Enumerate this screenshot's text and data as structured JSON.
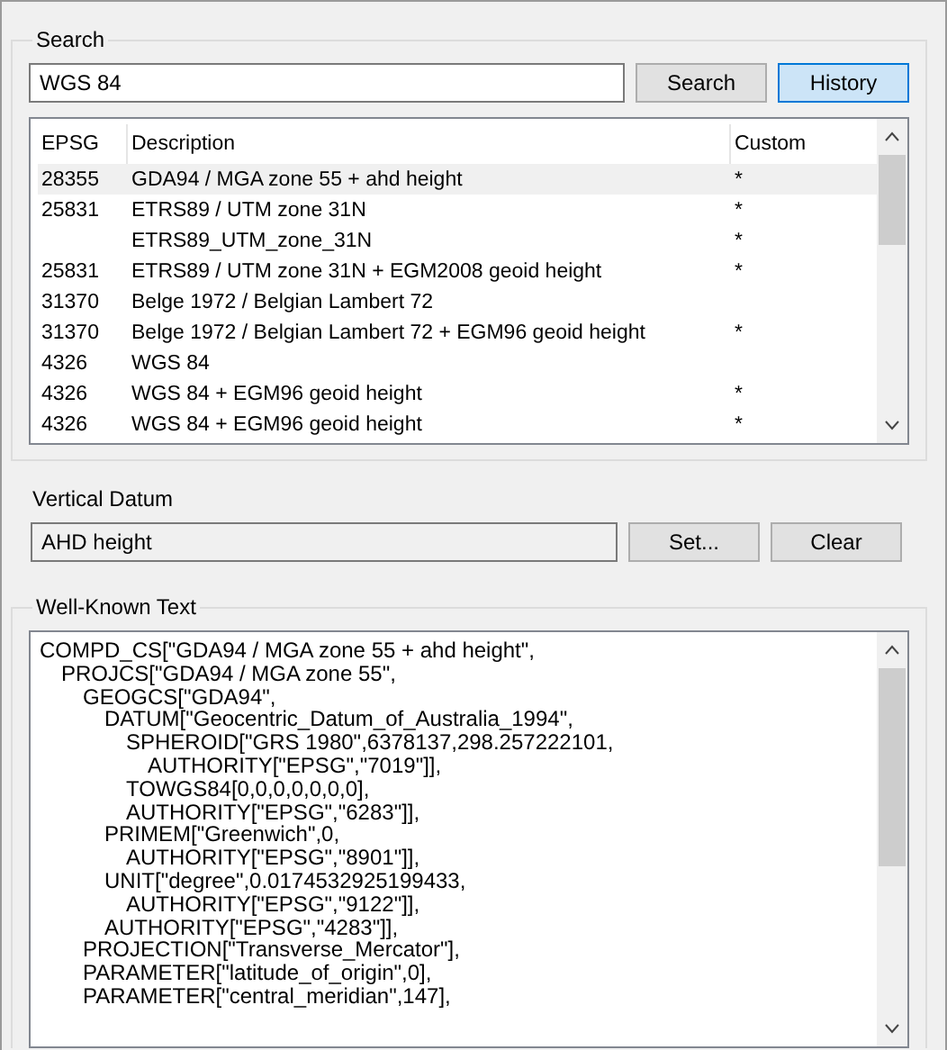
{
  "search": {
    "title": "Search",
    "query": "WGS 84",
    "buttons": [
      {
        "label": "Search",
        "selected": false
      },
      {
        "label": "History",
        "selected": true
      }
    ]
  },
  "table": {
    "columns": [
      "EPSG",
      "Description",
      "Custom"
    ],
    "rows": [
      {
        "epsg": "28355",
        "description": "GDA94 / MGA zone 55 + ahd height",
        "custom": "*",
        "selected": true
      },
      {
        "epsg": "25831",
        "description": "ETRS89 / UTM zone 31N",
        "custom": "*",
        "selected": false
      },
      {
        "epsg": "",
        "description": "ETRS89_UTM_zone_31N",
        "custom": "*",
        "selected": false
      },
      {
        "epsg": "25831",
        "description": "ETRS89 / UTM zone 31N + EGM2008 geoid height",
        "custom": "*",
        "selected": false
      },
      {
        "epsg": "31370",
        "description": "Belge 1972 / Belgian Lambert 72",
        "custom": "",
        "selected": false
      },
      {
        "epsg": "31370",
        "description": "Belge 1972 / Belgian Lambert 72 + EGM96 geoid height",
        "custom": "*",
        "selected": false
      },
      {
        "epsg": "4326",
        "description": "WGS 84",
        "custom": "",
        "selected": false
      },
      {
        "epsg": "4326",
        "description": "WGS 84 + EGM96 geoid height",
        "custom": "*",
        "selected": false
      },
      {
        "epsg": "4326",
        "description": "WGS 84 + EGM96 geoid height",
        "custom": "*",
        "selected": false
      }
    ]
  },
  "vertical_datum": {
    "label": "Vertical Datum",
    "value": "AHD height",
    "buttons": [
      "Set...",
      "Clear"
    ]
  },
  "wkt": {
    "title": "Well-Known Text",
    "lines": [
      {
        "text": "COMPD_CS[\"GDA94 / MGA zone 55 + ahd height\",",
        "children": [
          {
            "text": "PROJCS[\"GDA94 / MGA zone 55\",",
            "children": [
              {
                "text": "GEOGCS[\"GDA94\",",
                "children": [
                  {
                    "text": "DATUM[\"Geocentric_Datum_of_Australia_1994\",",
                    "children": [
                      {
                        "text": "SPHEROID[\"GRS 1980\",6378137,298.257222101,",
                        "children": [
                          {
                            "text": "AUTHORITY[\"EPSG\",\"7019\"]],"
                          }
                        ]
                      },
                      {
                        "text": "TOWGS84[0,0,0,0,0,0,0],"
                      },
                      {
                        "text": "AUTHORITY[\"EPSG\",\"6283\"]],"
                      }
                    ]
                  },
                  {
                    "text": "PRIMEM[\"Greenwich\",0,",
                    "children": [
                      {
                        "text": "AUTHORITY[\"EPSG\",\"8901\"]],"
                      }
                    ]
                  },
                  {
                    "text": "UNIT[\"degree\",0.0174532925199433,",
                    "children": [
                      {
                        "text": "AUTHORITY[\"EPSG\",\"9122\"]],"
                      }
                    ]
                  },
                  {
                    "text": "AUTHORITY[\"EPSG\",\"4283\"]],"
                  }
                ]
              },
              {
                "text": "PROJECTION[\"Transverse_Mercator\"],"
              },
              {
                "text": "PARAMETER[\"latitude_of_origin\",0],"
              },
              {
                "text": "PARAMETER[\"central_meridian\",147],"
              }
            ]
          }
        ]
      }
    ]
  }
}
